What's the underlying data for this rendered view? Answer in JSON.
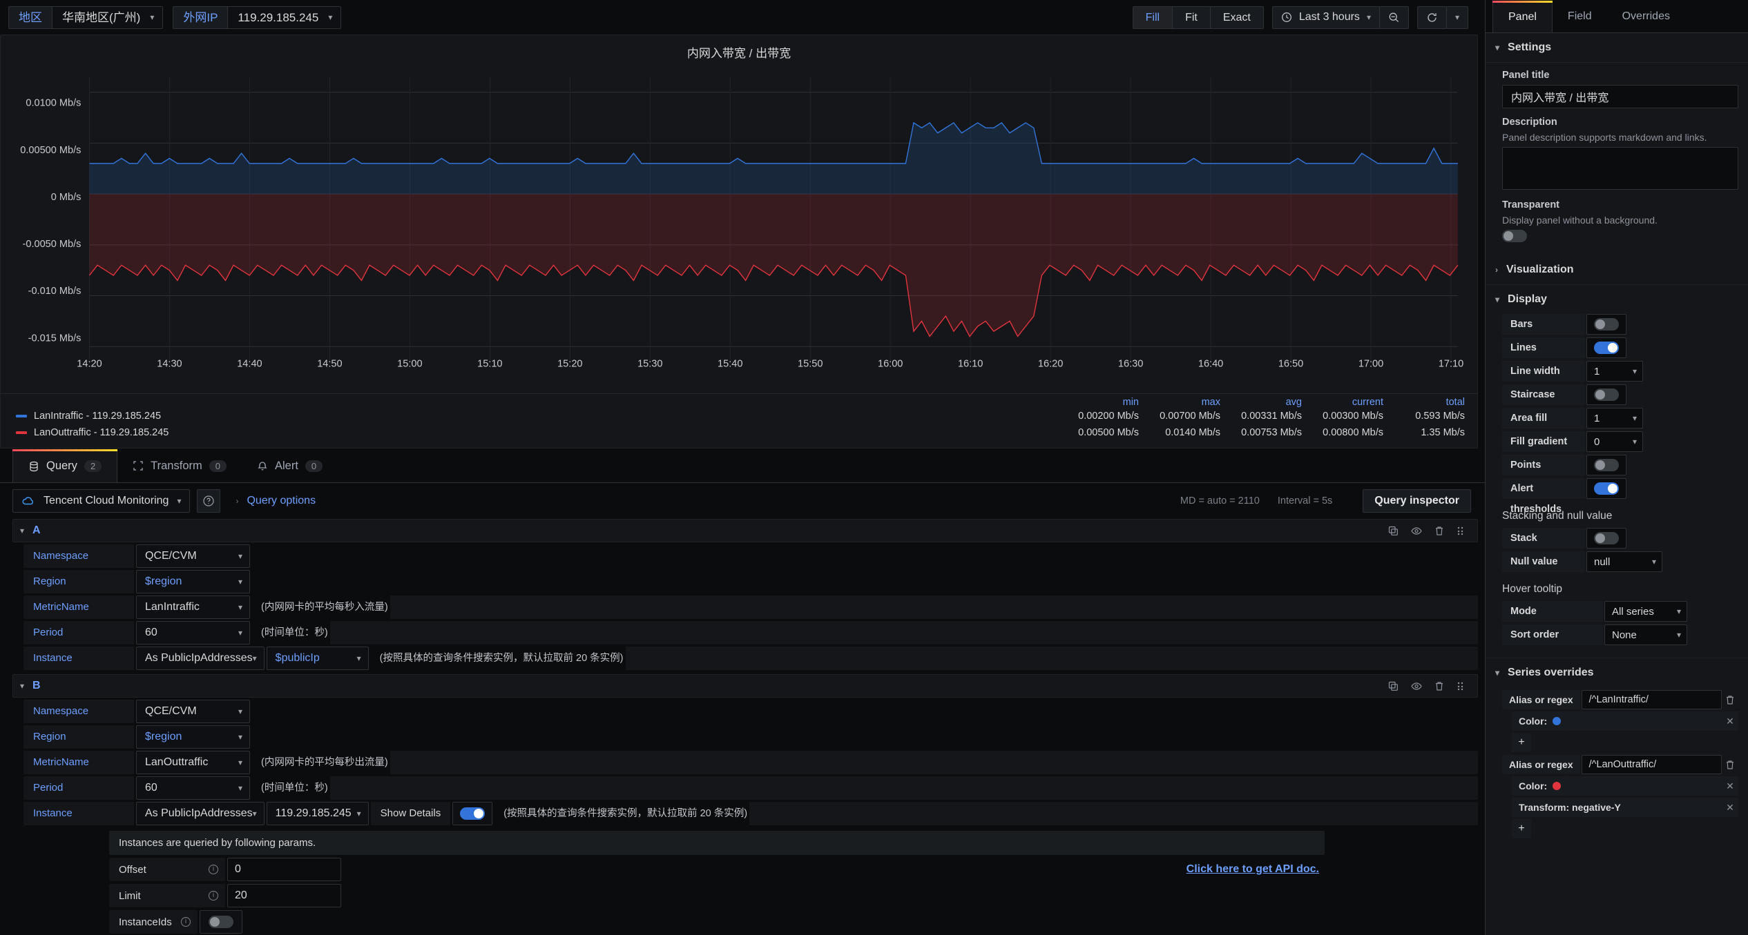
{
  "toolbar": {
    "variables": [
      {
        "label": "地区",
        "value": "华南地区(广州)",
        "name": "region"
      },
      {
        "label": "外网IP",
        "value": "119.29.185.245",
        "name": "publicip"
      }
    ],
    "fit_buttons": [
      {
        "label": "Fill",
        "active": true
      },
      {
        "label": "Fit",
        "active": false
      },
      {
        "label": "Exact",
        "active": false
      }
    ],
    "time_range": "Last 3 hours",
    "zoom_out_icon": "zoom-out-icon",
    "refresh_icon": "refresh-icon"
  },
  "panel": {
    "title": "内网入带宽 / 出带宽",
    "legend": {
      "columns": [
        "min",
        "max",
        "avg",
        "current",
        "total"
      ],
      "series": [
        {
          "name": "LanIntraffic - 119.29.185.245",
          "color": "#3274d9",
          "values": [
            "0.00200 Mb/s",
            "0.00700 Mb/s",
            "0.00331 Mb/s",
            "0.00300 Mb/s",
            "0.593 Mb/s"
          ]
        },
        {
          "name": "LanOuttraffic - 119.29.185.245",
          "color": "#e0343f",
          "values": [
            "0.00500 Mb/s",
            "0.0140 Mb/s",
            "0.00753 Mb/s",
            "0.00800 Mb/s",
            "1.35 Mb/s"
          ]
        }
      ]
    }
  },
  "chart_data": {
    "type": "area",
    "title": "内网入带宽 / 出带宽",
    "xlabel": "",
    "ylabel": "Mb/s",
    "ylim": [
      -0.0165,
      0.0115
    ],
    "yticks": [
      0.01,
      0.005,
      0,
      -0.005,
      -0.01,
      -0.015
    ],
    "ytick_labels": [
      "0.0100 Mb/s",
      "0.00500 Mb/s",
      "0 Mb/s",
      "-0.0050 Mb/s",
      "-0.010 Mb/s",
      "-0.015 Mb/s"
    ],
    "xticks": [
      "14:20",
      "14:30",
      "14:40",
      "14:50",
      "15:00",
      "15:10",
      "15:20",
      "15:30",
      "15:40",
      "15:50",
      "16:00",
      "16:10",
      "16:20",
      "16:30",
      "16:40",
      "16:50",
      "17:00",
      "17:10"
    ],
    "grid": true,
    "legend_position": "bottom",
    "series": [
      {
        "name": "LanIntraffic - 119.29.185.245",
        "color": "#3274d9",
        "values": [
          0.003,
          0.003,
          0.003,
          0.003,
          0.0035,
          0.003,
          0.003,
          0.004,
          0.003,
          0.003,
          0.0035,
          0.003,
          0.003,
          0.003,
          0.003,
          0.0035,
          0.003,
          0.003,
          0.003,
          0.004,
          0.003,
          0.003,
          0.003,
          0.003,
          0.003,
          0.0035,
          0.003,
          0.003,
          0.003,
          0.003,
          0.003,
          0.003,
          0.003,
          0.0035,
          0.003,
          0.003,
          0.003,
          0.003,
          0.003,
          0.003,
          0.003,
          0.003,
          0.003,
          0.003,
          0.0035,
          0.003,
          0.003,
          0.003,
          0.003,
          0.003,
          0.0035,
          0.003,
          0.003,
          0.003,
          0.003,
          0.003,
          0.003,
          0.003,
          0.003,
          0.003,
          0.003,
          0.0035,
          0.003,
          0.003,
          0.003,
          0.003,
          0.003,
          0.003,
          0.004,
          0.003,
          0.003,
          0.003,
          0.003,
          0.003,
          0.003,
          0.003,
          0.003,
          0.003,
          0.003,
          0.003,
          0.003,
          0.0035,
          0.003,
          0.003,
          0.003,
          0.003,
          0.003,
          0.003,
          0.003,
          0.003,
          0.003,
          0.003,
          0.003,
          0.003,
          0.003,
          0.003,
          0.003,
          0.003,
          0.003,
          0.003,
          0.003,
          0.003,
          0.003,
          0.007,
          0.0065,
          0.007,
          0.006,
          0.0065,
          0.007,
          0.006,
          0.0065,
          0.007,
          0.0065,
          0.0065,
          0.007,
          0.006,
          0.0065,
          0.007,
          0.0065,
          0.003,
          0.003,
          0.003,
          0.003,
          0.003,
          0.003,
          0.003,
          0.003,
          0.003,
          0.003,
          0.003,
          0.003,
          0.003,
          0.003,
          0.003,
          0.003,
          0.003,
          0.003,
          0.003,
          0.0035,
          0.003,
          0.003,
          0.003,
          0.003,
          0.003,
          0.003,
          0.003,
          0.003,
          0.003,
          0.003,
          0.003,
          0.003,
          0.0035,
          0.003,
          0.003,
          0.003,
          0.003,
          0.003,
          0.003,
          0.003,
          0.004,
          0.0035,
          0.003,
          0.003,
          0.003,
          0.003,
          0.003,
          0.003,
          0.003,
          0.0045,
          0.003,
          0.003,
          0.003
        ]
      },
      {
        "name": "LanOuttraffic - 119.29.185.245",
        "color": "#e0343f",
        "transform": "negative-Y",
        "values": [
          0.008,
          0.007,
          0.0075,
          0.008,
          0.007,
          0.0075,
          0.008,
          0.007,
          0.008,
          0.007,
          0.0075,
          0.0085,
          0.007,
          0.0075,
          0.008,
          0.007,
          0.0075,
          0.0085,
          0.007,
          0.0075,
          0.008,
          0.007,
          0.0075,
          0.008,
          0.007,
          0.0075,
          0.008,
          0.007,
          0.008,
          0.007,
          0.0075,
          0.008,
          0.007,
          0.0075,
          0.0085,
          0.007,
          0.0075,
          0.008,
          0.007,
          0.0075,
          0.008,
          0.007,
          0.008,
          0.007,
          0.0075,
          0.008,
          0.007,
          0.0075,
          0.008,
          0.007,
          0.0075,
          0.0085,
          0.007,
          0.0075,
          0.008,
          0.007,
          0.0075,
          0.008,
          0.007,
          0.008,
          0.0075,
          0.007,
          0.008,
          0.007,
          0.0075,
          0.008,
          0.007,
          0.0075,
          0.0085,
          0.007,
          0.0075,
          0.008,
          0.007,
          0.0075,
          0.008,
          0.007,
          0.008,
          0.007,
          0.0075,
          0.008,
          0.007,
          0.0075,
          0.0085,
          0.007,
          0.0075,
          0.008,
          0.007,
          0.0075,
          0.008,
          0.007,
          0.0075,
          0.008,
          0.007,
          0.008,
          0.007,
          0.0075,
          0.008,
          0.007,
          0.0075,
          0.0085,
          0.007,
          0.0075,
          0.008,
          0.0135,
          0.0125,
          0.014,
          0.013,
          0.012,
          0.0135,
          0.0125,
          0.014,
          0.013,
          0.0125,
          0.0135,
          0.013,
          0.0125,
          0.014,
          0.013,
          0.012,
          0.008,
          0.007,
          0.0075,
          0.008,
          0.007,
          0.0075,
          0.0085,
          0.007,
          0.0075,
          0.008,
          0.007,
          0.0075,
          0.008,
          0.007,
          0.008,
          0.007,
          0.0075,
          0.008,
          0.007,
          0.0075,
          0.0085,
          0.007,
          0.0075,
          0.008,
          0.007,
          0.0075,
          0.008,
          0.007,
          0.008,
          0.007,
          0.0075,
          0.008,
          0.007,
          0.0075,
          0.0085,
          0.007,
          0.0075,
          0.008,
          0.007,
          0.0075,
          0.008,
          0.007,
          0.008,
          0.007,
          0.0075,
          0.008,
          0.007,
          0.0075,
          0.0085,
          0.007,
          0.0075,
          0.008,
          0.007
        ]
      }
    ]
  },
  "editor_tabs": [
    {
      "label": "Query",
      "count": "2",
      "icon": "database-icon",
      "active": true
    },
    {
      "label": "Transform",
      "count": "0",
      "icon": "transform-icon",
      "active": false
    },
    {
      "label": "Alert",
      "count": "0",
      "icon": "bell-icon",
      "active": false
    }
  ],
  "datasource": {
    "name": "Tencent Cloud Monitoring",
    "help_icon": "help-circle-icon",
    "query_options_label": "Query options",
    "md_info": "MD = auto = 2110",
    "interval_info": "Interval = 5s",
    "query_inspector_label": "Query inspector"
  },
  "queries": [
    {
      "name": "A",
      "fields": [
        {
          "label": "Namespace",
          "value": "QCE/CVM",
          "hint": "",
          "variable": false
        },
        {
          "label": "Region",
          "value": "$region",
          "hint": "",
          "variable": true
        },
        {
          "label": "MetricName",
          "value": "LanIntraffic",
          "hint": "(内网网卡的平均每秒入流量)",
          "variable": false
        },
        {
          "label": "Period",
          "value": "60",
          "hint": "(时间单位：秒)",
          "variable": false
        }
      ],
      "instance": {
        "label": "Instance",
        "mode": "As PublicIpAddresses",
        "value": "$publicIp",
        "value_is_variable": true,
        "hint": "(按照具体的查询条件搜索实例，默认拉取前 20 条实例)",
        "show_details": null,
        "details_on": false
      }
    },
    {
      "name": "B",
      "fields": [
        {
          "label": "Namespace",
          "value": "QCE/CVM",
          "hint": "",
          "variable": false
        },
        {
          "label": "Region",
          "value": "$region",
          "hint": "",
          "variable": true
        },
        {
          "label": "MetricName",
          "value": "LanOuttraffic",
          "hint": "(内网网卡的平均每秒出流量)",
          "variable": false
        },
        {
          "label": "Period",
          "value": "60",
          "hint": "(时间单位：秒)",
          "variable": false
        }
      ],
      "instance": {
        "label": "Instance",
        "mode": "As PublicIpAddresses",
        "value": "119.29.185.245",
        "value_is_variable": false,
        "hint": "(按照具体的查询条件搜索实例，默认拉取前 20 条实例)",
        "show_details": "Show Details",
        "details_on": true
      }
    }
  ],
  "instance_details": {
    "header": "Instances are queried by following params.",
    "api_doc_link": "Click here to get API doc.",
    "rows": [
      {
        "label": "Offset",
        "value": "0",
        "type": "input"
      },
      {
        "label": "Limit",
        "value": "20",
        "type": "input"
      }
    ],
    "toggle_row": {
      "label": "InstanceIds",
      "on": false
    }
  },
  "options": {
    "tabs": [
      {
        "label": "Panel",
        "active": true
      },
      {
        "label": "Field",
        "active": false
      },
      {
        "label": "Overrides",
        "active": false
      }
    ],
    "settings": {
      "title": "Settings",
      "panel_title_label": "Panel title",
      "panel_title_value": "内网入带宽 / 出带宽",
      "description_label": "Description",
      "description_sub": "Panel description supports markdown and links.",
      "description_value": "",
      "transparent_label": "Transparent",
      "transparent_sub": "Display panel without a background.",
      "transparent_on": false
    },
    "visualization": {
      "title": "Visualization"
    },
    "display": {
      "title": "Display",
      "rows": [
        {
          "label": "Bars",
          "type": "toggle",
          "on": false
        },
        {
          "label": "Lines",
          "type": "toggle",
          "on": true
        },
        {
          "label": "Line width",
          "type": "select",
          "value": "1"
        },
        {
          "label": "Staircase",
          "type": "toggle",
          "on": false
        },
        {
          "label": "Area fill",
          "type": "select",
          "value": "1"
        },
        {
          "label": "Fill gradient",
          "type": "select",
          "value": "0"
        },
        {
          "label": "Points",
          "type": "toggle",
          "on": false
        },
        {
          "label": "Alert thresholds",
          "type": "toggle",
          "on": true
        }
      ],
      "stacking_title": "Stacking and null value",
      "stacking_rows": [
        {
          "label": "Stack",
          "type": "toggle",
          "on": false
        },
        {
          "label": "Null value",
          "type": "select",
          "value": "null"
        }
      ],
      "tooltip_title": "Hover tooltip",
      "tooltip_rows": [
        {
          "label": "Mode",
          "type": "select",
          "value": "All series"
        },
        {
          "label": "Sort order",
          "type": "select",
          "value": "None"
        }
      ]
    },
    "series_overrides": {
      "title": "Series overrides",
      "items": [
        {
          "label": "Alias or regex",
          "value": "/^LanIntraffic/",
          "props": [
            {
              "kind": "color",
              "label": "Color:",
              "color": "#3274d9"
            }
          ]
        },
        {
          "label": "Alias or regex",
          "value": "/^LanOuttraffic/",
          "props": [
            {
              "kind": "color",
              "label": "Color:",
              "color": "#e0343f"
            },
            {
              "kind": "text",
              "label": "Transform: negative-Y"
            }
          ]
        }
      ]
    }
  }
}
